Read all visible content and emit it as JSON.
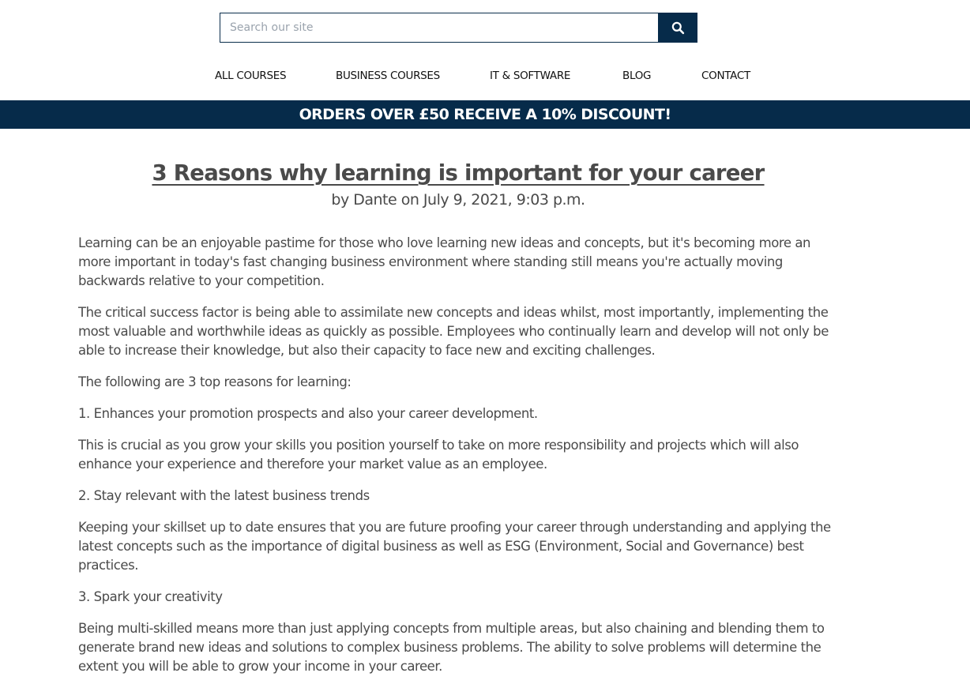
{
  "search": {
    "placeholder": "Search our site",
    "value": "",
    "button_icon": "search-icon"
  },
  "nav": {
    "items": [
      {
        "label": "ALL COURSES"
      },
      {
        "label": "BUSINESS COURSES"
      },
      {
        "label": "IT & SOFTWARE"
      },
      {
        "label": "BLOG"
      },
      {
        "label": "CONTACT"
      }
    ]
  },
  "banner": {
    "text": "ORDERS OVER £50 RECEIVE A 10% DISCOUNT!"
  },
  "article": {
    "title": "3 Reasons why learning is important for your career",
    "byline": "by Dante on July 9, 2021, 9:03 p.m.",
    "paragraphs": [
      "Learning can be an enjoyable pastime for those who love learning new ideas and concepts, but it's becoming more an more important in today's fast changing business environment where standing still means you're actually moving backwards relative to your competition.",
      "The critical success factor is being able to assimilate new concepts and ideas whilst, most importantly, implementing the most valuable and worthwhile ideas as quickly as possible. Employees who continually learn and develop will not only be able to increase their knowledge, but also their capacity to face new and exciting challenges.",
      "The following are 3 top reasons for learning:",
      "1. Enhances your promotion prospects and also your career development.",
      "This is crucial as you grow your skills you position yourself to take on more responsibility and projects which will also enhance your experience and therefore your market value as an employee.",
      "2. Stay relevant with the latest business trends",
      "Keeping your skillset up to date ensures that you are future proofing your career through understanding and applying the latest concepts such as the importance of digital business as well as ESG (Environment, Social and Governance) best practices.",
      "3. Spark your creativity",
      "Being multi-skilled means more than just applying concepts from multiple areas, but also chaining and blending them to generate brand new ideas and solutions to complex business problems. The ability to solve problems will determine the extent you will be able to grow your income in your career."
    ]
  },
  "colors": {
    "brand_navy": "#062b4a",
    "text": "#4a4a4a",
    "banner_text": "#ffffff"
  }
}
